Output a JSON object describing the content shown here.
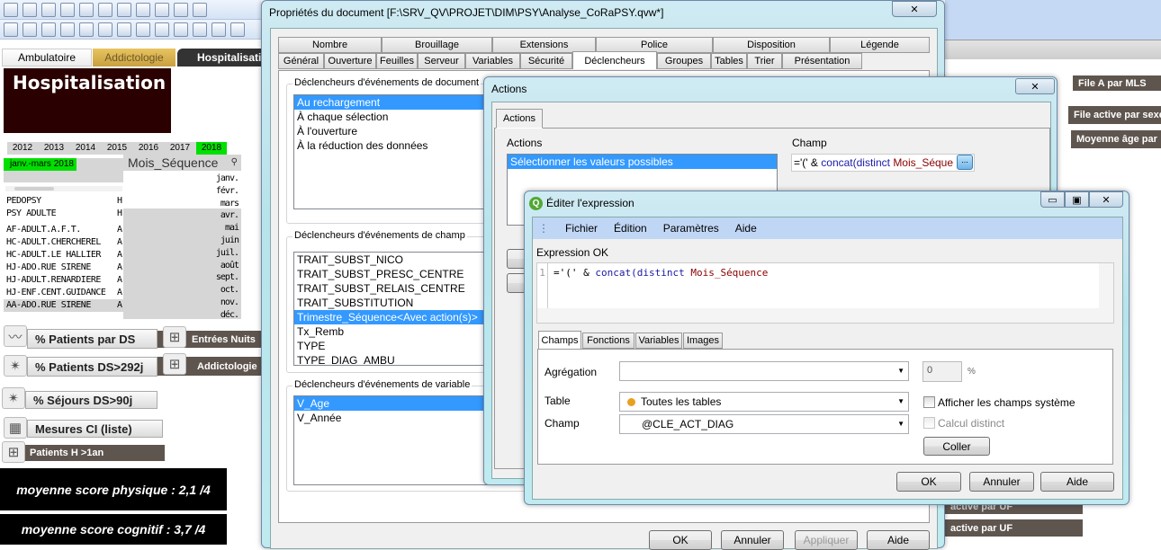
{
  "app": {
    "sheet_tabs": [
      "Ambulatoire",
      "Addictologie",
      "Hospitalisation"
    ],
    "title_box": "Hospitalisation",
    "years": [
      "2012",
      "2013",
      "2014",
      "2015",
      "2016",
      "2017",
      "2018"
    ],
    "selected_year": "2018",
    "current_selection": "janv.-mars 2018",
    "mois_header": "Mois_Séquence",
    "months": [
      "janv.",
      "févr.",
      "mars",
      "avr.",
      "mai",
      "juin",
      "juil.",
      "août",
      "sept.",
      "oct.",
      "nov.",
      "déc."
    ],
    "left_list": [
      "PEDOPSY",
      "PSY ADULTE",
      "AF-ADULT.A.F.T.",
      "HC-ADULT.CHERCHEREL",
      "HC-ADULT.LE HALLIER",
      "HJ-ADO.RUE SIRENE",
      "HJ-ADULT.RENARDIERE",
      "HJ-ENF.CENT.GUIDANCE",
      "AA-ADO.RUE SIRENE"
    ],
    "left_list_col2": [
      "H",
      "H",
      "A",
      "A",
      "A",
      "A",
      "A",
      "A",
      "A"
    ],
    "buttons": {
      "patients_ds": "% Patients par DS",
      "entrees_nuits": "Entrées Nuits",
      "patients_ds292": "% Patients DS>292j",
      "addictologie": "Addictologie",
      "sejours_ds90": "% Séjours DS>90j",
      "mesures_ci": "Mesures CI (liste)",
      "patients_h1an": "Patients H >1an"
    },
    "score_physique": "moyenne score physique : 2,1 /4",
    "score_cognitif": "moyenne score cognitif : 3,7 /4",
    "right_buttons": [
      "File A par MLS",
      "File active par sexe",
      "Moyenne âge par",
      "active par UF",
      "active par UF"
    ],
    "colors": {
      "selected_green": "#00e000",
      "brown_button": "#5e554e",
      "title_box_bg": "#2a0000",
      "selection_blue": "#3399ff"
    }
  },
  "props": {
    "title": "Propriétés du document [F:\\SRV_QV\\PROJET\\DIM\\PSY\\Analyse_CoRaPSY.qvw*]",
    "tabs_row1": [
      "Nombre",
      "Brouillage",
      "Extensions",
      "Police",
      "Disposition",
      "Légende"
    ],
    "tabs_row2": [
      "Général",
      "Ouverture",
      "Feuilles",
      "Serveur",
      "Variables",
      "Sécurité",
      "Déclencheurs",
      "Groupes",
      "Tables",
      "Trier",
      "Présentation"
    ],
    "active_tab": "Déclencheurs",
    "doc_group": "Déclencheurs d'événements de document",
    "doc_events": [
      "Au rechargement",
      "À chaque sélection",
      "À l'ouverture",
      "À la réduction des données"
    ],
    "field_group": "Déclencheurs d'événements de champ",
    "field_events": [
      "TRAIT_SUBST_NICO",
      "TRAIT_SUBST_PRESC_CENTRE",
      "TRAIT_SUBST_RELAIS_CENTRE",
      "TRAIT_SUBSTITUTION",
      "Trimestre_Séquence<Avec action(s)>",
      "Tx_Remb",
      "TYPE",
      "TYPE_DIAG_AMBU"
    ],
    "var_group": "Déclencheurs d'événements de variable",
    "var_events": [
      "V_Age",
      "V_Année"
    ],
    "ok": "OK",
    "cancel": "Annuler",
    "apply": "Appliquer",
    "help": "Aide"
  },
  "actions": {
    "title": "Actions",
    "tab": "Actions",
    "actions_label": "Actions",
    "champ_label": "Champ",
    "list": [
      "Sélectionner les valeurs possibles"
    ],
    "champ_value_a": "='(' & ",
    "champ_value_b": "concat(distinct ",
    "champ_value_c": "Mois_Séque",
    "browse": "..."
  },
  "expr": {
    "title": "Éditer l'expression",
    "menu": [
      "Fichier",
      "Édition",
      "Paramètres",
      "Aide"
    ],
    "status": "Expression OK",
    "line_no": "1",
    "code_a": "='(' & ",
    "code_b": "concat(distinct ",
    "code_c": "Mois_Séquence",
    ",code_d": ",'|') & ')'",
    "tabs": [
      "Champs",
      "Fonctions",
      "Variables",
      "Images"
    ],
    "aggregation_label": "Agrégation",
    "aggregation_value": "",
    "percent_value": "0",
    "percent_sign": "%",
    "table_label": "Table",
    "table_value": "Toutes les tables",
    "champ_label": "Champ",
    "champ_value": "@CLE_ACT_DIAG",
    "show_system": "Afficher les champs système",
    "show_system_checked": false,
    "distinct": "Calcul distinct",
    "distinct_checked": false,
    "paste": "Coller",
    "ok": "OK",
    "cancel": "Annuler",
    "help": "Aide"
  }
}
